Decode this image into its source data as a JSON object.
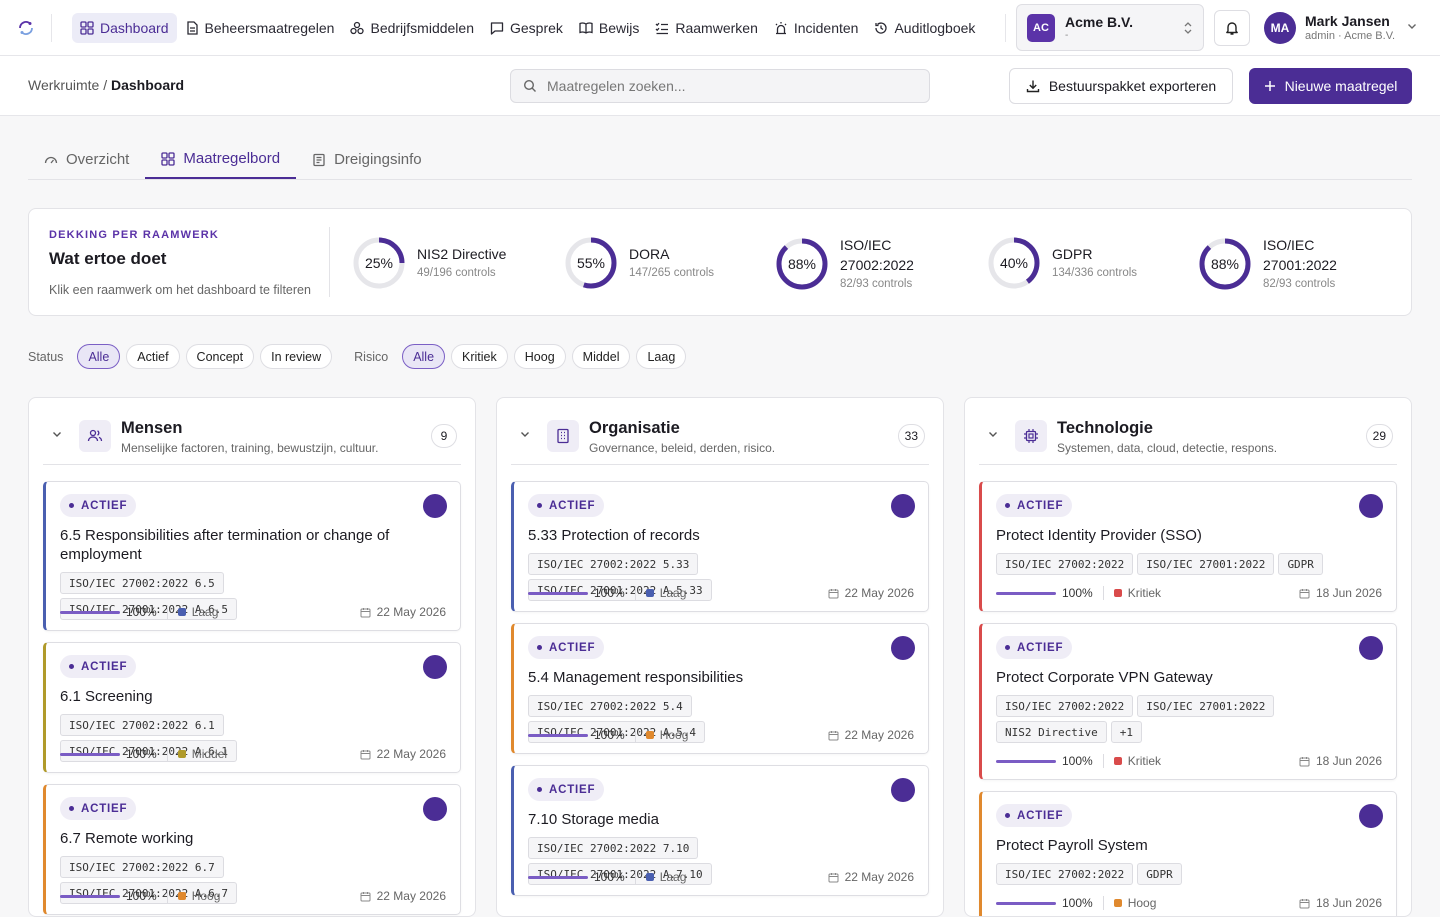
{
  "topnav": {
    "items": [
      {
        "label": "Dashboard",
        "icon": "dashboard-icon"
      },
      {
        "label": "Beheersmaatregelen",
        "icon": "document-icon"
      },
      {
        "label": "Bedrijfsmiddelen",
        "icon": "assets-icon"
      },
      {
        "label": "Gesprek",
        "icon": "chat-icon"
      },
      {
        "label": "Bewijs",
        "icon": "book-icon"
      },
      {
        "label": "Raamwerken",
        "icon": "list-check-icon"
      },
      {
        "label": "Incidenten",
        "icon": "siren-icon"
      },
      {
        "label": "Auditlogboek",
        "icon": "history-icon"
      }
    ],
    "org": {
      "initials": "AC",
      "name": "Acme B.V.",
      "sub": "-"
    },
    "user": {
      "initials": "MA",
      "name": "Mark Jansen",
      "sub": "admin · Acme B.V."
    }
  },
  "subbar": {
    "crumb_root": "Werkruimte",
    "crumb_sep": "/",
    "crumb_current": "Dashboard",
    "search_placeholder": "Maatregelen zoeken...",
    "export_label": "Bestuurspakket exporteren",
    "new_label": "Nieuwe maatregel"
  },
  "tabs": [
    {
      "label": "Overzicht",
      "icon": "gauge-icon"
    },
    {
      "label": "Maatregelbord",
      "icon": "grid-icon"
    },
    {
      "label": "Dreigingsinfo",
      "icon": "newspaper-icon"
    }
  ],
  "coverage": {
    "kicker": "DEKKING PER RAAMWERK",
    "title": "Wat ertoe doet",
    "hint": "Klik een raamwerk om het dashboard te filteren",
    "frameworks": [
      {
        "pct_label": "25%",
        "pct": 25,
        "name": "NIS2 Directive",
        "controls": "49/196 controls"
      },
      {
        "pct_label": "55%",
        "pct": 55,
        "name": "DORA",
        "controls": "147/265 controls"
      },
      {
        "pct_label": "88%",
        "pct": 88,
        "name": "ISO/IEC 27002:2022",
        "controls": "82/93 controls"
      },
      {
        "pct_label": "40%",
        "pct": 40,
        "name": "GDPR",
        "controls": "134/336 controls"
      },
      {
        "pct_label": "88%",
        "pct": 88,
        "name": "ISO/IEC 27001:2022",
        "controls": "82/93 controls"
      }
    ]
  },
  "filters": {
    "status_label": "Status",
    "status": [
      "Alle",
      "Actief",
      "Concept",
      "In review"
    ],
    "risk_label": "Risico",
    "risk": [
      "Alle",
      "Kritiek",
      "Hoog",
      "Middel",
      "Laag"
    ]
  },
  "colors": {
    "accent": "#4b2d95",
    "Laag": "#4a5fb0",
    "Middel": "#b09a2a",
    "Hoog": "#e0892e",
    "Kritiek": "#d94b4b"
  },
  "columns": [
    {
      "title": "Mensen",
      "desc": "Menselijke factoren, training, bewustzijn, cultuur.",
      "count": "9",
      "icon": "people-icon",
      "cards": [
        {
          "status": "ACTIEF",
          "title": "6.5 Responsibilities after termination or change of employment",
          "tags": [
            "ISO/IEC 27002:2022 6.5",
            "ISO/IEC 27001:2022 A.6.5"
          ],
          "progress": "100%",
          "risk": "Laag",
          "date": "22 May 2026"
        },
        {
          "status": "ACTIEF",
          "title": "6.1 Screening",
          "tags": [
            "ISO/IEC 27002:2022 6.1",
            "ISO/IEC 27001:2022 A.6.1"
          ],
          "progress": "100%",
          "risk": "Middel",
          "date": "22 May 2026"
        },
        {
          "status": "ACTIEF",
          "title": "6.7 Remote working",
          "tags": [
            "ISO/IEC 27002:2022 6.7",
            "ISO/IEC 27001:2022 A.6.7"
          ],
          "progress": "100%",
          "risk": "Hoog",
          "date": "22 May 2026"
        }
      ]
    },
    {
      "title": "Organisatie",
      "desc": "Governance, beleid, derden, risico.",
      "count": "33",
      "icon": "building-icon",
      "cards": [
        {
          "status": "ACTIEF",
          "title": "5.33 Protection of records",
          "tags": [
            "ISO/IEC 27002:2022 5.33",
            "ISO/IEC 27001:2022 A.5.33"
          ],
          "progress": "100%",
          "risk": "Laag",
          "date": "22 May 2026"
        },
        {
          "status": "ACTIEF",
          "title": "5.4 Management responsibilities",
          "tags": [
            "ISO/IEC 27002:2022 5.4",
            "ISO/IEC 27001:2022 A.5.4"
          ],
          "progress": "100%",
          "risk": "Hoog",
          "date": "22 May 2026"
        },
        {
          "status": "ACTIEF",
          "title": "7.10 Storage media",
          "tags": [
            "ISO/IEC 27002:2022 7.10",
            "ISO/IEC 27001:2022 A.7.10"
          ],
          "progress": "100%",
          "risk": "Laag",
          "date": "22 May 2026"
        }
      ]
    },
    {
      "title": "Technologie",
      "desc": "Systemen, data, cloud, detectie, respons.",
      "count": "29",
      "icon": "chip-icon",
      "cards": [
        {
          "status": "ACTIEF",
          "title": "Protect Identity Provider (SSO)",
          "tags": [
            "ISO/IEC 27002:2022",
            "ISO/IEC 27001:2022",
            "GDPR"
          ],
          "progress": "100%",
          "risk": "Kritiek",
          "date": "18 Jun 2026"
        },
        {
          "status": "ACTIEF",
          "title": "Protect Corporate VPN Gateway",
          "tags": [
            "ISO/IEC 27002:2022",
            "ISO/IEC 27001:2022",
            "NIS2 Directive",
            "+1"
          ],
          "progress": "100%",
          "risk": "Kritiek",
          "date": "18 Jun 2026"
        },
        {
          "status": "ACTIEF",
          "title": "Protect Payroll System",
          "tags": [
            "ISO/IEC 27002:2022",
            "GDPR"
          ],
          "progress": "100%",
          "risk": "Hoog",
          "date": "18 Jun 2026"
        }
      ]
    }
  ]
}
